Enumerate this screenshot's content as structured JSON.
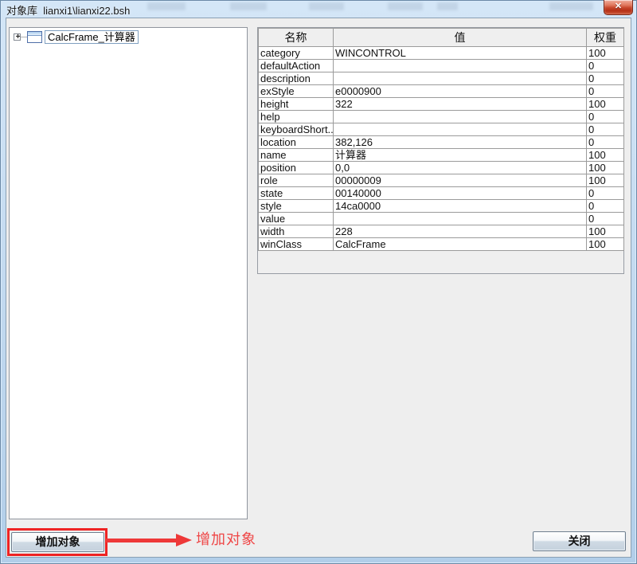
{
  "window": {
    "title": "对象库  lianxi1\\lianxi22.bsh",
    "close_glyph": "✕"
  },
  "tree": {
    "expand_glyph": "+",
    "root_label": "CalcFrame_计算器"
  },
  "table": {
    "headers": [
      "名称",
      "值",
      "权重"
    ],
    "rows": [
      {
        "name": "category",
        "value": "WINCONTROL",
        "weight": "100"
      },
      {
        "name": "defaultAction",
        "value": "",
        "weight": "0"
      },
      {
        "name": "description",
        "value": "",
        "weight": "0"
      },
      {
        "name": "exStyle",
        "value": "e0000900",
        "weight": "0"
      },
      {
        "name": "height",
        "value": "322",
        "weight": "100"
      },
      {
        "name": "help",
        "value": "",
        "weight": "0"
      },
      {
        "name": "keyboardShort...",
        "value": "",
        "weight": "0"
      },
      {
        "name": "location",
        "value": "382,126",
        "weight": "0"
      },
      {
        "name": "name",
        "value": "计算器",
        "weight": "100"
      },
      {
        "name": "position",
        "value": "0,0",
        "weight": "100"
      },
      {
        "name": "role",
        "value": "00000009",
        "weight": "100"
      },
      {
        "name": "state",
        "value": "00140000",
        "weight": "0"
      },
      {
        "name": "style",
        "value": "14ca0000",
        "weight": "0"
      },
      {
        "name": "value",
        "value": "",
        "weight": "0"
      },
      {
        "name": "width",
        "value": "228",
        "weight": "100"
      },
      {
        "name": "winClass",
        "value": "CalcFrame",
        "weight": "100"
      }
    ]
  },
  "buttons": {
    "add_object": "增加对象",
    "close": "关闭"
  },
  "annotation": {
    "label": "增加对象",
    "color": "#ef4545",
    "highlight_color": "#ee2323"
  }
}
